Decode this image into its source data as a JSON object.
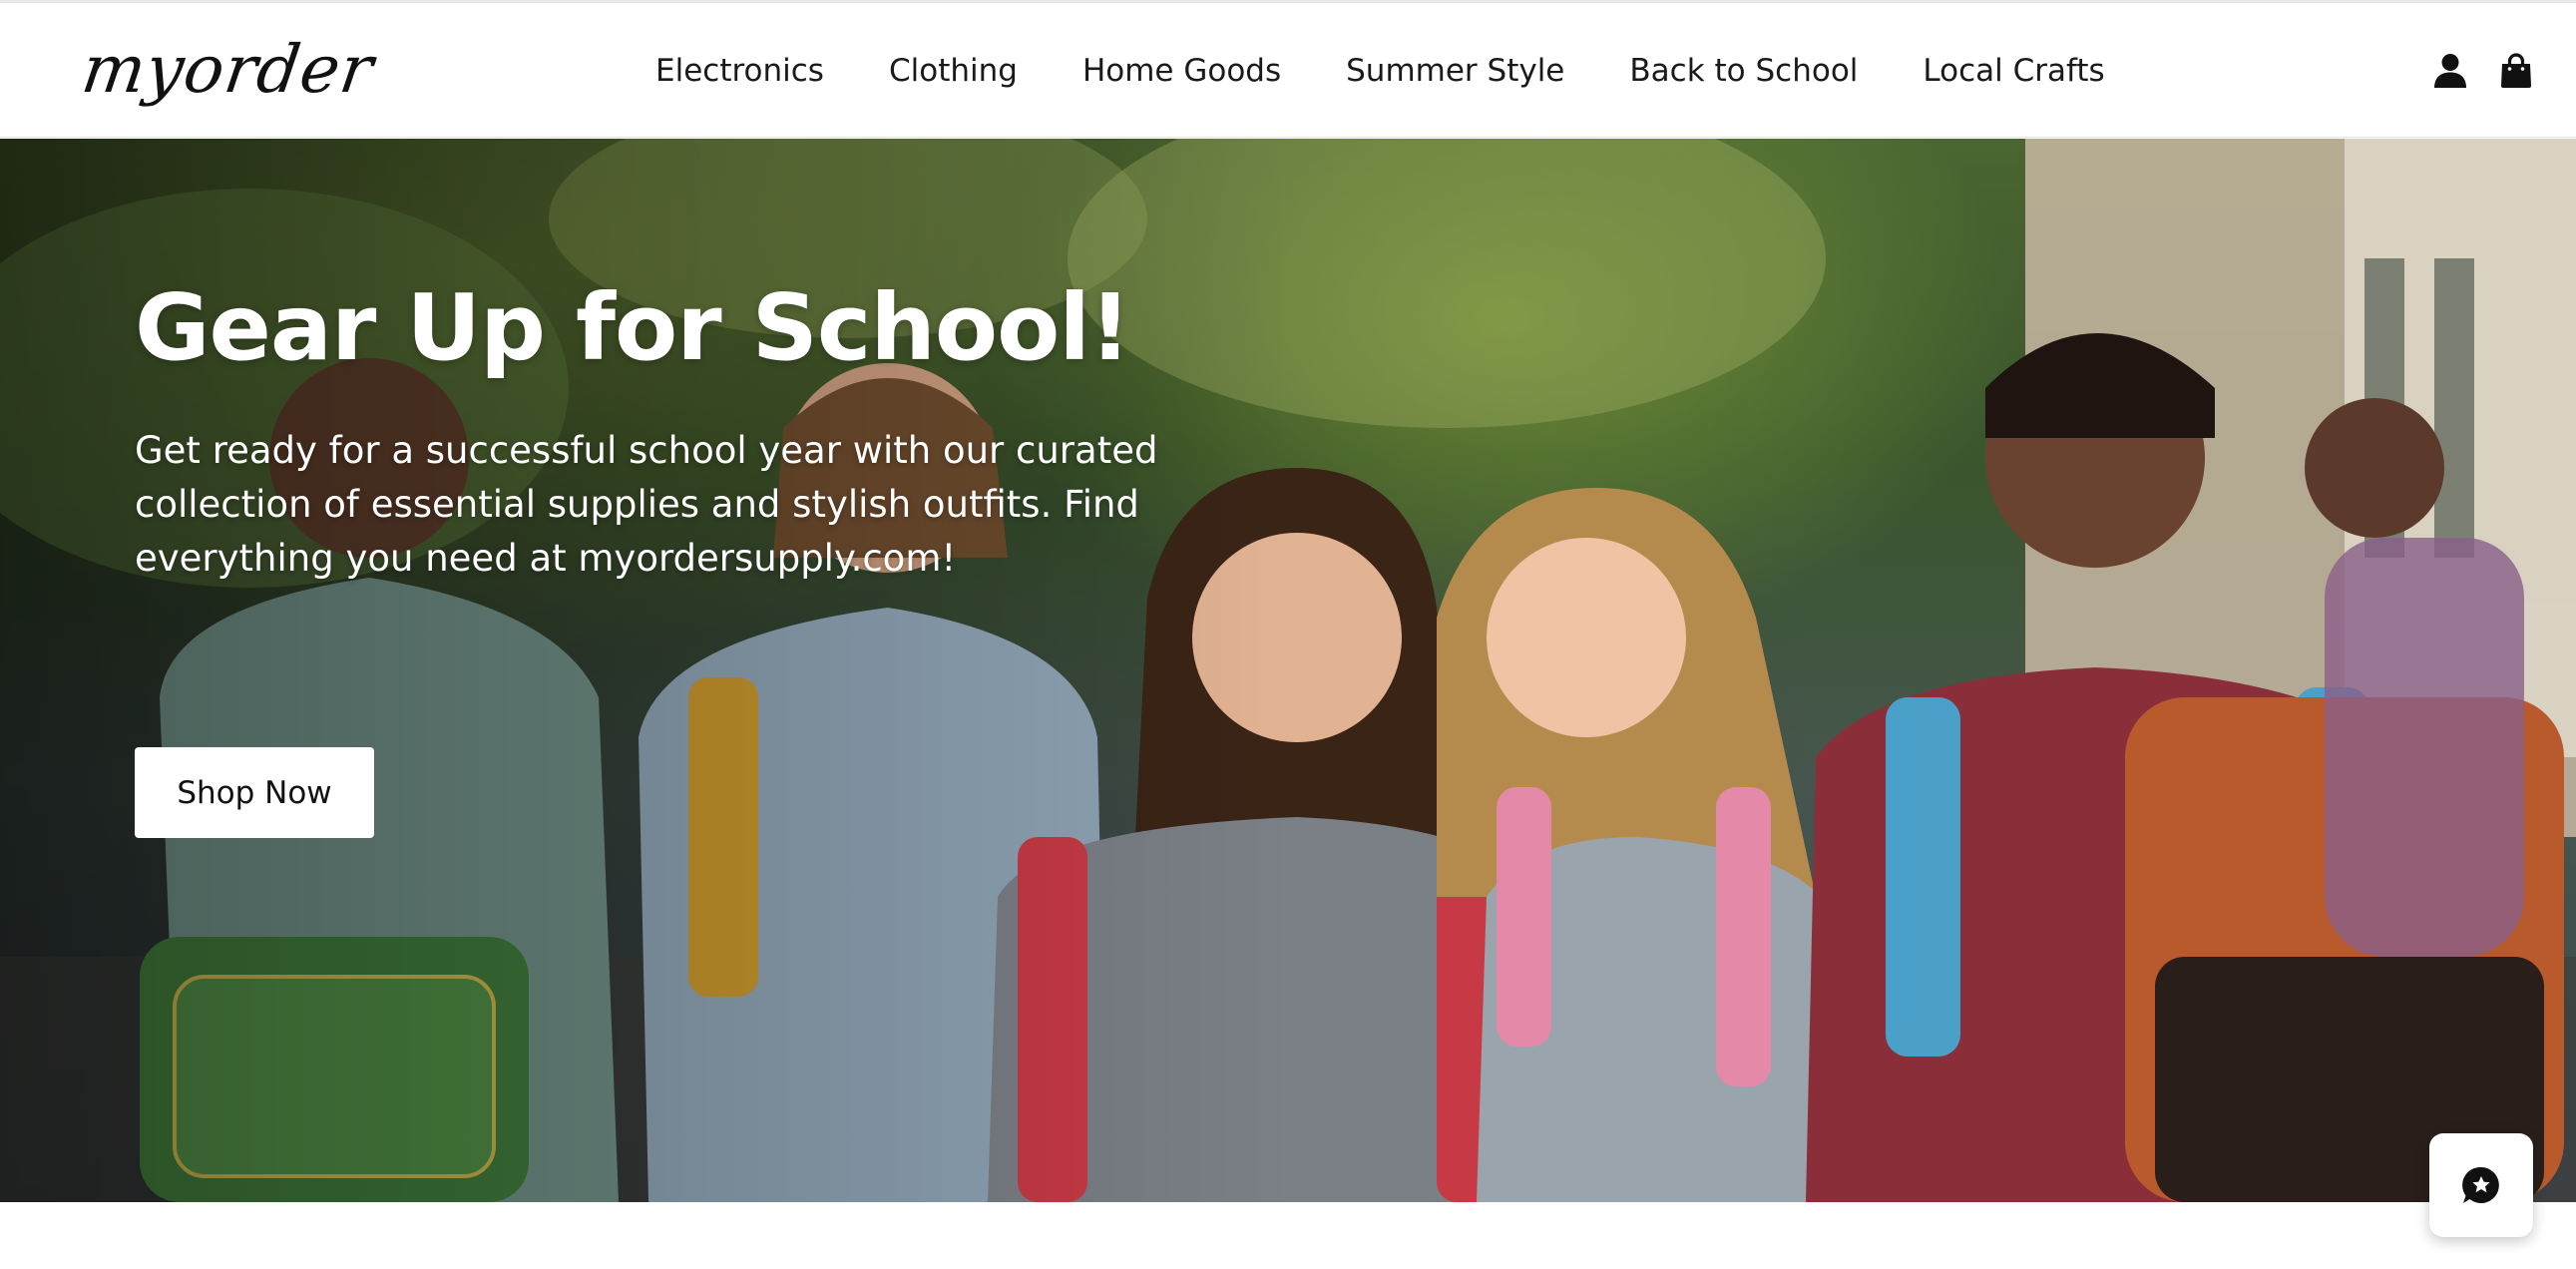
{
  "brand": {
    "logo_text": "myorder"
  },
  "nav": {
    "items": [
      {
        "label": "Electronics"
      },
      {
        "label": "Clothing"
      },
      {
        "label": "Home Goods"
      },
      {
        "label": "Summer Style"
      },
      {
        "label": "Back to School"
      },
      {
        "label": "Local Crafts"
      }
    ]
  },
  "header_icons": [
    {
      "name": "account-icon"
    },
    {
      "name": "shopping-bag-icon"
    }
  ],
  "hero": {
    "title": "Gear Up for School!",
    "description": "Get ready for a successful school year with our curated collection of essential supplies and stylish outfits. Find everything you need at myordersupply.com!",
    "cta_label": "Shop Now",
    "image_subject": "group of smiling students walking outdoors with backpacks"
  },
  "chat_widget": {
    "icon": "chat-star-icon"
  },
  "colors": {
    "header_bg": "#ffffff",
    "text": "#111111",
    "hero_text": "#ffffff",
    "button_bg": "#ffffff"
  }
}
